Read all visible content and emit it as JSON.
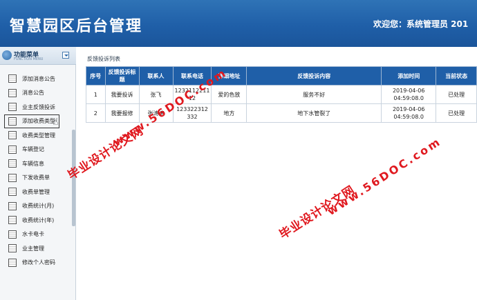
{
  "header": {
    "title": "智慧园区后台管理",
    "welcome": "欢迎您：系统管理员  201"
  },
  "sidebar": {
    "title": "功能菜单",
    "subtitle": "FUNCTION MENU",
    "items": [
      {
        "label": "添加消息公告"
      },
      {
        "label": "消息公告"
      },
      {
        "label": "业主反馈投诉"
      },
      {
        "label": "添加收费类型"
      },
      {
        "label": "收费类型管理"
      },
      {
        "label": "车辆登记"
      },
      {
        "label": "车辆信息"
      },
      {
        "label": "下发收费单"
      },
      {
        "label": "收费单管理"
      },
      {
        "label": "收费统计(月)"
      },
      {
        "label": "收费统计(年)"
      },
      {
        "label": "水卡电卡"
      },
      {
        "label": "业主管理"
      },
      {
        "label": "修改个人密码"
      }
    ]
  },
  "main": {
    "section_title": "反馈投诉列表",
    "table": {
      "headers": [
        "序号",
        "反馈投诉标题",
        "联系人",
        "联系电话",
        "详细地址",
        "反馈投诉内容",
        "添加时间",
        "当前状态"
      ],
      "rows": [
        [
          "1",
          "我要投诉",
          "张飞",
          "1232112211 12",
          "爱的色放",
          "服务不好",
          "2019-04-06 04:59:08.0",
          "已处理"
        ],
        [
          "2",
          "我要报修",
          "张涛涛",
          "123322312 332",
          "地方",
          "地下水管裂了",
          "2019-04-06 04:59:08.0",
          "已处理"
        ]
      ]
    }
  },
  "watermark": {
    "cn": "毕业设计论文网",
    "url": "www.56DOC.com"
  },
  "colors": {
    "header_bg": "#1f5fa8",
    "table_header_bg": "#1f5fa8",
    "watermark": "#e0191f"
  }
}
